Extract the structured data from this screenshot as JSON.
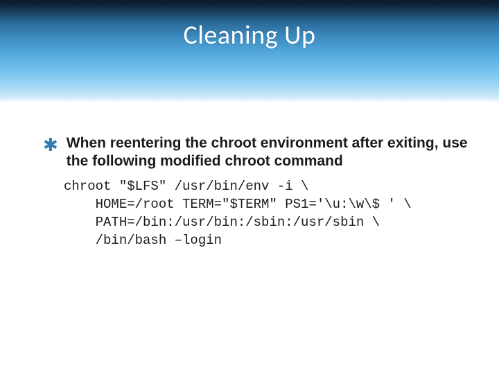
{
  "title": "Cleaning Up",
  "bullet_marker": "✱",
  "bullet_text": "When reentering the chroot environment after exiting, use the following modified chroot command",
  "code": "chroot \"$LFS\" /usr/bin/env -i \\\n    HOME=/root TERM=\"$TERM\" PS1='\\u:\\w\\$ ' \\\n    PATH=/bin:/usr/bin:/sbin:/usr/sbin \\\n    /bin/bash –login"
}
